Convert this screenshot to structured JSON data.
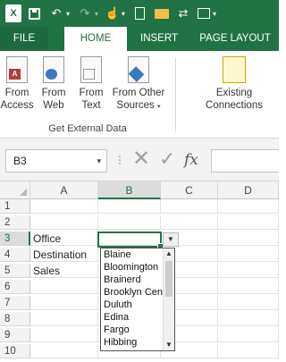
{
  "qat": {
    "app_logo": "X",
    "icons": [
      "excel-logo-icon",
      "save-icon",
      "undo-icon",
      "redo-icon",
      "touch-mode-icon",
      "new-file-icon",
      "open-folder-icon",
      "connections-icon",
      "form-icon"
    ],
    "undo_glyph": "↶",
    "redo_glyph": "↷",
    "dd_glyph": "▾",
    "touch_glyph": "☝",
    "conn_glyph": "⇄"
  },
  "tabs": [
    {
      "label": "FILE"
    },
    {
      "label": "HOME"
    },
    {
      "label": "INSERT"
    },
    {
      "label": "PAGE LAYOUT"
    }
  ],
  "ribbon": {
    "buttons": [
      {
        "line1": "From",
        "line2": "Access",
        "mark": "A",
        "icon": "access-icon"
      },
      {
        "line1": "From",
        "line2": "Web",
        "mark": "",
        "icon": "web-icon"
      },
      {
        "line1": "From",
        "line2": "Text",
        "mark": "",
        "icon": "text-file-icon"
      },
      {
        "line1": "From Other",
        "line2": "Sources",
        "mark": "",
        "icon": "other-sources-icon"
      },
      {
        "line1": "Existing",
        "line2": "Connections",
        "mark": "",
        "icon": "existing-connections-icon"
      }
    ],
    "group_label": "Get External Data"
  },
  "formula_bar": {
    "name_box": "B3",
    "name_box_dd": "▾",
    "dots": "⋮",
    "cancel": "✕",
    "enter": "✓",
    "fx": "fx",
    "value": ""
  },
  "grid": {
    "columns": [
      "A",
      "B",
      "C",
      "D"
    ],
    "selected_column": "B",
    "rows": [
      {
        "num": "1",
        "a": "",
        "b": ""
      },
      {
        "num": "2",
        "a": "",
        "b": ""
      },
      {
        "num": "3",
        "a": "Office",
        "b": ""
      },
      {
        "num": "4",
        "a": "Destination",
        "b": ""
      },
      {
        "num": "5",
        "a": "Sales",
        "b": ""
      },
      {
        "num": "6",
        "a": "",
        "b": ""
      },
      {
        "num": "7",
        "a": "",
        "b": ""
      },
      {
        "num": "8",
        "a": "",
        "b": ""
      },
      {
        "num": "9",
        "a": "",
        "b": ""
      },
      {
        "num": "10",
        "a": "",
        "b": ""
      }
    ],
    "selected_row": "3"
  },
  "dropdown": {
    "button_glyph": "▼",
    "items": [
      "Blaine",
      "Bloomington",
      "Brainerd",
      "Brooklyn Center",
      "Duluth",
      "Edina",
      "Fargo",
      "Hibbing"
    ],
    "scroll_up": "▲",
    "scroll_down": "▼"
  }
}
